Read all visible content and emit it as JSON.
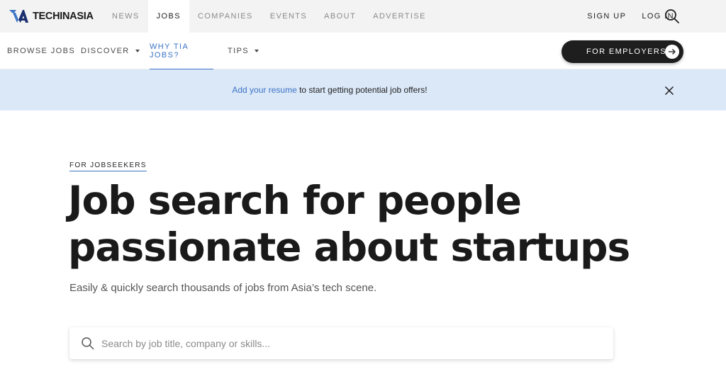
{
  "brand": {
    "logo_text": "TECHINASIA",
    "logo_mark": "techinasia-logo-icon"
  },
  "topnav": {
    "links": [
      {
        "label": "NEWS",
        "active": false
      },
      {
        "label": "JOBS",
        "active": true
      },
      {
        "label": "COMPANIES",
        "active": false
      },
      {
        "label": "EVENTS",
        "active": false
      },
      {
        "label": "ABOUT",
        "active": false
      },
      {
        "label": "ADVERTISE",
        "active": false
      }
    ],
    "signup": "SIGN UP",
    "login": "LOG IN",
    "search_icon": "search-icon"
  },
  "subnav": {
    "items": [
      {
        "label": "BROWSE JOBS",
        "has_dropdown": false,
        "active": false
      },
      {
        "label": "DISCOVER",
        "has_dropdown": true,
        "active": false
      },
      {
        "label": "WHY TIA JOBS?",
        "has_dropdown": false,
        "active": true
      },
      {
        "label": "TIPS",
        "has_dropdown": true,
        "active": false
      }
    ],
    "employers_button": "FOR EMPLOYERS",
    "employers_icon": "arrow-right-icon"
  },
  "banner": {
    "link_text": "Add your resume",
    "text": " to start getting potential job offers!",
    "close_icon": "close-icon"
  },
  "hero": {
    "eyebrow": "FOR JOBSEEKERS",
    "headline_line1": "Job search for people",
    "headline_line2": "passionate about startups",
    "subheading": "Easily & quickly search thousands of jobs from Asia’s tech scene."
  },
  "search": {
    "placeholder": "Search by job title, company or skills...",
    "value": ""
  },
  "colors": {
    "accent": "#3d74c5",
    "banner_bg": "#dbe8f8",
    "dark_button": "#1e1e1e",
    "topnav_bg": "#f3f3f3"
  }
}
